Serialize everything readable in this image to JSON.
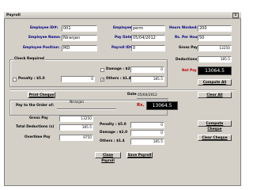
{
  "window": {
    "title": "Payroll",
    "close": "x"
  },
  "employee": {
    "id_label": "Employee ID#:",
    "id_value": "001",
    "name_label": "Employee Name:",
    "name_value": "Niranjan",
    "position_label": "Employee Position:",
    "position_value": "MD",
    "status_label": "Employee Status:",
    "status_value": "perm",
    "paydate_label": "Pay Date:",
    "paydate_value": "05/04/2012",
    "payrollid_label": "Payroll ID#:",
    "payrollid_value": "0",
    "hours_label": "Hours Worked:",
    "hours_value": "200",
    "rate_label": "Rs. Per Hour",
    "rate_value": "50",
    "grosspay_label": "Gross Pay :",
    "grosspay_value": "13250",
    "deductions_label": "Deductions :",
    "deductions_value": "185.5",
    "netpay_label": "Net Pay :",
    "netpay_value": "13064.5"
  },
  "check_required": {
    "group_label": "Check Required",
    "damage_label": "Damage : $2.0",
    "damage_checked": false,
    "damage_value": "0",
    "penalty_label": "Penalty : $5.0",
    "penalty_checked": false,
    "penalty_value": "0",
    "others_label": "Others : $1.4",
    "others_checked": true,
    "others_value": "185.5"
  },
  "actions": {
    "compute_all": "Compute All",
    "clear_all": "Clear All"
  },
  "cheque": {
    "print_label": "Print Cheque",
    "date_label": "Date:",
    "date_value": "05/04/2012",
    "payto_label": "Pay to the Order of:",
    "payto_value": "Niranjan",
    "rs_label": "Rs.",
    "amount_value": "13064.5",
    "grosspay_label": "Gross Pay",
    "grosspay_value": "13250",
    "totaldeductions_label": "Total Deductions (s)",
    "totaldeductions_value": "185.5",
    "overtime_label": "Overtime Pay",
    "overtime_value": "9750",
    "penalty_label": "Penalty : $5.0",
    "penalty_value": "0",
    "damage_label": "Damage : $2.0",
    "damage_value": "0",
    "others_label": "Others : $1.4",
    "others_value": "185.5",
    "compute_button": "Compute Cheque",
    "clear_button": "Clear Cheque"
  },
  "footer": {
    "close_button": "Close Payroll",
    "save_button": "Save Payroll"
  }
}
